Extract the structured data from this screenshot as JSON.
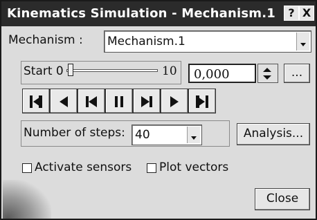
{
  "window": {
    "title": "Kinematics Simulation - Mechanism.1",
    "help_label": "?",
    "close_label": "X"
  },
  "mechanism": {
    "label": "Mechanism :",
    "value": "Mechanism.1"
  },
  "slider": {
    "start_label": "Start 0",
    "end_label": "10",
    "value": "0,000",
    "more_label": "..."
  },
  "player": {
    "buttons": [
      "skip-to-start",
      "step-back",
      "play-backward",
      "pause",
      "play-forward",
      "step-forward",
      "skip-to-end"
    ]
  },
  "steps": {
    "label": "Number of steps:",
    "value": "40"
  },
  "analysis_label": "Analysis...",
  "checkboxes": {
    "sensors_label": "Activate sensors",
    "sensors_checked": false,
    "vectors_label": "Plot vectors",
    "vectors_checked": false
  },
  "close_label": "Close"
}
